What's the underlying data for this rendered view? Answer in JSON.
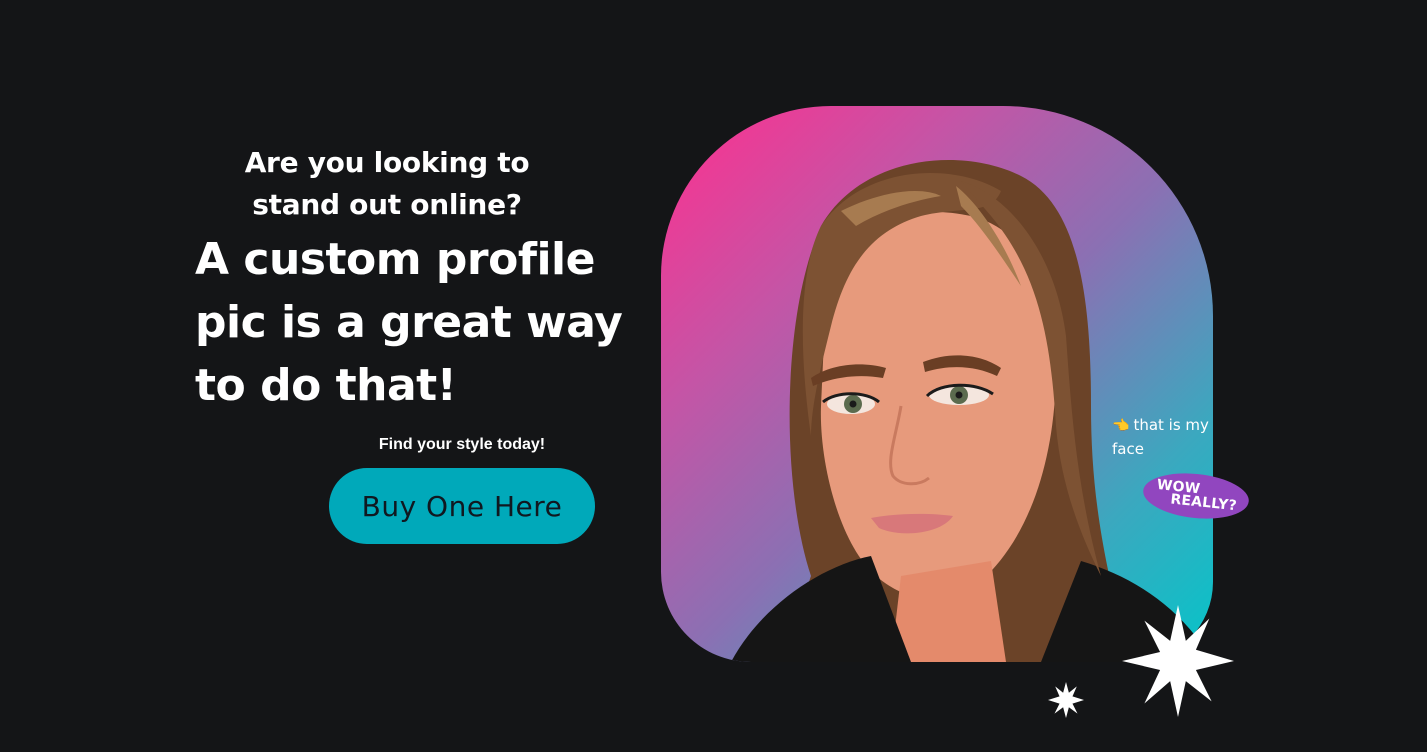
{
  "hero": {
    "subheading": "Are you looking to stand out online?",
    "headline": "A custom profile pic is a great way to do that!",
    "tagline": "Find your style today!",
    "cta_label": "Buy One Here"
  },
  "portrait": {
    "annotation_icon": "pointing-hand-icon",
    "annotation_pointer": "👈",
    "annotation_text": "that is my face",
    "badge_line1": "WOW",
    "badge_line2": "REALLY?"
  },
  "colors": {
    "background": "#141517",
    "cta": "#00a9ba",
    "gradient_pink": "#ff2f8e",
    "gradient_teal": "#04c5c9",
    "badge_purple": "#9146bf"
  },
  "decorations": [
    "sparkle-star-icon",
    "sparkle-star-icon"
  ]
}
